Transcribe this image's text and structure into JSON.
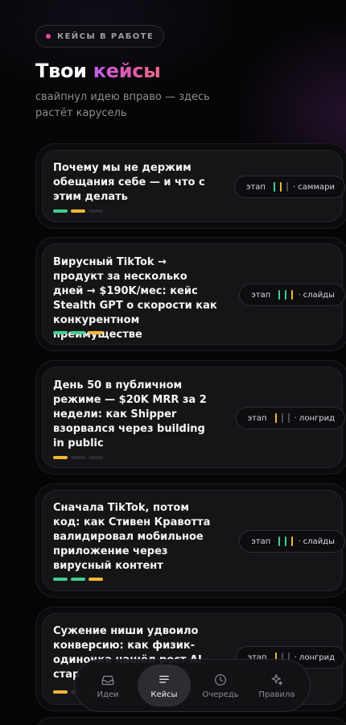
{
  "header": {
    "badge": "КЕЙСЫ В РАБОТЕ",
    "title_main": "Твои",
    "title_accent": "кейсы",
    "subtitle": "свайпнул идею вправо — здесь растёт карусель"
  },
  "stage_label": "этап",
  "cards": [
    {
      "title": "Почему мы не держим обещания себе — и что с этим делать",
      "progress": [
        "done",
        "current",
        "todo"
      ],
      "stage_ticks": [
        "green",
        "yellow",
        "gray"
      ],
      "stage_name": "· саммари"
    },
    {
      "title": "Вирусный TikTok → продукт за несколько дней → $190K/мес: кейс Stealth GPT о скорости как конкурентном преимуществе",
      "progress": [
        "done",
        "done",
        "current"
      ],
      "stage_ticks": [
        "green",
        "green",
        "yellow"
      ],
      "stage_name": "· слайды"
    },
    {
      "title": "День 50 в публичном режиме — $20K MRR за 2 недели: как Shipper взорвался через building in public",
      "progress": [
        "current",
        "todo",
        "todo"
      ],
      "stage_ticks": [
        "yellow",
        "gray",
        "gray"
      ],
      "stage_name": "· лонгрид"
    },
    {
      "title": "Сначала TikTok, потом код: как Стивен Кравотта валидировал мобильное приложение через вирусный контент",
      "progress": [
        "done",
        "done",
        "current"
      ],
      "stage_ticks": [
        "green",
        "green",
        "yellow"
      ],
      "stage_name": "· слайды"
    },
    {
      "title": "Сужение ниши удвоило конверсию: как физик-одиночка нашёл рост AI стар",
      "progress": [
        "current",
        "todo",
        "todo"
      ],
      "stage_ticks": [
        "yellow",
        "gray",
        "gray"
      ],
      "stage_name": "· лонгрид"
    }
  ],
  "nav": {
    "items": [
      {
        "label": "Идеи",
        "icon": "inbox-icon",
        "active": false
      },
      {
        "label": "Кейсы",
        "icon": "list-icon",
        "active": true
      },
      {
        "label": "Очередь",
        "icon": "clock-icon",
        "active": false
      },
      {
        "label": "Правила",
        "icon": "sparkle-icon",
        "active": false
      }
    ]
  },
  "colors": {
    "accent_gradient_start": "#c25ee8",
    "accent_gradient_end": "#f06b8e",
    "progress_done": "#3fcf8e",
    "progress_current": "#f2b632",
    "badge_dot": "#e24d9a"
  }
}
